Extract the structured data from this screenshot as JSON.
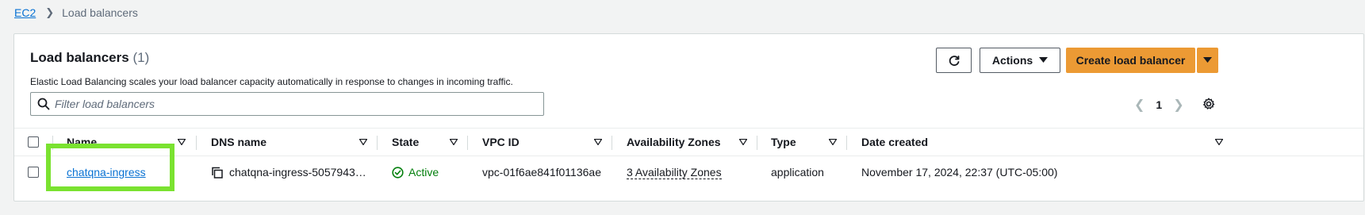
{
  "breadcrumb": {
    "parent": "EC2",
    "current": "Load balancers"
  },
  "panel": {
    "title": "Load balancers",
    "count": "(1)",
    "description": "Elastic Load Balancing scales your load balancer capacity automatically in response to changes in incoming traffic."
  },
  "toolbar": {
    "actions_label": "Actions",
    "create_label": "Create load balancer"
  },
  "filter": {
    "placeholder": "Filter load balancers"
  },
  "pagination": {
    "current_page": "1"
  },
  "table": {
    "columns": {
      "name": "Name",
      "dns": "DNS name",
      "state": "State",
      "vpc": "VPC ID",
      "az": "Availability Zones",
      "type": "Type",
      "date": "Date created"
    },
    "rows": [
      {
        "name": "chatqna-ingress",
        "dns": "chatqna-ingress-5057943…",
        "state": "Active",
        "vpc": "vpc-01f6ae841f01136ae",
        "az": "3 Availability Zones",
        "type": "application",
        "date": "November 17, 2024, 22:37 (UTC-05:00)"
      }
    ]
  },
  "colors": {
    "primary_button": "#ec9a34",
    "link": "#0972d3",
    "success": "#037f0c",
    "highlight": "#7ae230"
  }
}
